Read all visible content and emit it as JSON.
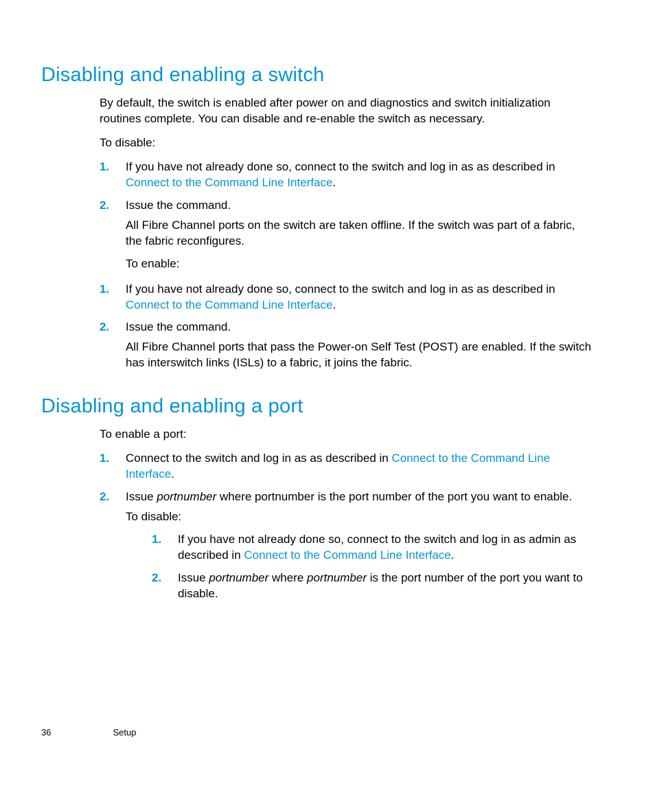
{
  "section1": {
    "heading": "Disabling and enabling a switch",
    "intro": "By default, the switch is enabled after power on and diagnostics and switch initialization routines complete. You can disable and re-enable the switch as necessary.",
    "to_disable_label": "To disable:",
    "disable_steps": {
      "s1_pre": "If you have not already done so, connect to the switch and log in as ",
      "s1_mid": " as described in ",
      "s1_link": "Connect to the Command Line Interface",
      "s1_end": ".",
      "s2_pre": "Issue the ",
      "s2_post": " command.",
      "s2_after1": "All Fibre Channel ports on the switch are taken offline. If the switch was part of a fabric, the fabric reconfigures.",
      "s2_after2": "To enable:"
    },
    "enable_steps": {
      "s1_pre": "If you have not already done so, connect to the switch and log in as ",
      "s1_mid": " as described in ",
      "s1_link": "Connect to the Command Line Interface",
      "s1_end": ".",
      "s2_pre": "Issue the ",
      "s2_post": " command.",
      "s2_after1": "All Fibre Channel ports that pass the Power-on Self Test (POST) are enabled. If the switch has interswitch links (ISLs) to a fabric, it joins the fabric."
    }
  },
  "section2": {
    "heading": "Disabling and enabling a port",
    "to_enable_label": "To enable a port:",
    "enable_steps": {
      "s1_pre": "Connect to the switch and log in as ",
      "s1_mid": " as described in ",
      "s1_link": "Connect to the Command Line Interface",
      "s1_end": ".",
      "s2_pre": "Issue ",
      "s2_arg": "portnumber",
      "s2_post": " where portnumber is the port number of the port you want to enable.",
      "s2_after": "To disable:"
    },
    "disable_steps": {
      "s1_pre": "If you have not already done so, connect to the switch and log in as admin as described in ",
      "s1_link": "Connect to the Command Line Interface",
      "s1_end": ".",
      "s2_pre": "Issue ",
      "s2_arg": "portnumber",
      "s2_mid": " where ",
      "s2_arg2": "portnumber",
      "s2_post": " is the port number of the port you want to disable."
    }
  },
  "markers": {
    "m1": "1.",
    "m2": "2."
  },
  "footer": {
    "page": "36",
    "chapter": "Setup"
  }
}
